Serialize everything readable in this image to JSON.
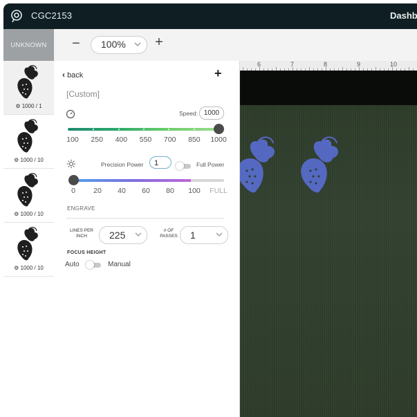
{
  "header": {
    "title": "CGC2153",
    "dashboard_label": "Dashbo"
  },
  "toolbar": {
    "unknown_label": "UNKNOWN",
    "zoom_value": "100%",
    "zoom_out_label": "−",
    "zoom_in_label": "+"
  },
  "ruler": {
    "labels": [
      "6",
      "7",
      "8",
      "9",
      "10"
    ]
  },
  "sidebar": {
    "items": [
      {
        "label": "1000 / 1"
      },
      {
        "label": "1000 / 10"
      },
      {
        "label": "1000 / 10"
      },
      {
        "label": "1000 / 10"
      }
    ]
  },
  "panel": {
    "back_label": "back",
    "add_label": "+",
    "preset_name": "[Custom]",
    "speed": {
      "label": "Speed:",
      "value": "1000",
      "ticks": [
        "100",
        "250",
        "400",
        "550",
        "700",
        "850",
        "1000"
      ],
      "level": 1.0
    },
    "power": {
      "label": "Precision Power",
      "value": "1",
      "full_power_label": "Full Power",
      "ticks": [
        "0",
        "20",
        "40",
        "60",
        "80",
        "100",
        "FULL"
      ],
      "level": 0.0
    },
    "engrave_label": "ENGRAVE",
    "lpi": {
      "label_line1": "LINES PER",
      "label_line2": "INCH",
      "value": "225"
    },
    "passes": {
      "label_line1": "# OF",
      "label_line2": "PASSES",
      "value": "1"
    },
    "focus": {
      "label": "FOCUS HEIGHT",
      "auto_label": "Auto",
      "manual_label": "Manual"
    }
  },
  "colors": {
    "header_bg": "#0f1e22",
    "speed_track": "#2aa86a",
    "power_track": "#7c6ee0",
    "artwork": "#5a6fd6"
  }
}
